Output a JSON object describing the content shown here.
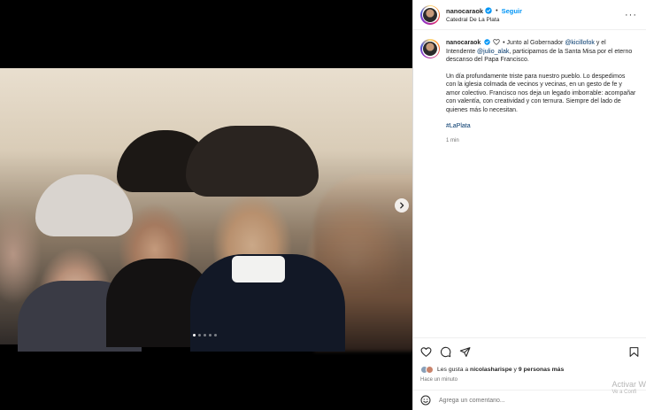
{
  "colors": {
    "accent": "#0095f6",
    "link": "#00376b",
    "muted": "#737373",
    "verified": "#0095f6"
  },
  "header": {
    "username": "nanocaraok",
    "separator": "•",
    "follow_label": "Seguir",
    "location": "Catedral De La Plata",
    "more_label": "···"
  },
  "media": {
    "slides_total": 5,
    "active_slide": 1
  },
  "caption": {
    "username": "nanocaraok",
    "pre_text": "• Junto al Gobernador",
    "mention1": "@kicillofok",
    "mid_text": "y el Intendente",
    "mention2": "@julio_alak",
    "post_text": ", participamos de la Santa Misa por el eterno descanso del Papa Francisco.",
    "paragraph": "Un día profundamente triste para nuestro pueblo. Lo despedimos con la iglesia colmada de vecinos y vecinas, en un gesto de fe y amor colectivo. Francisco nos deja un legado imborrable: acompañar con valentía, con creatividad y con ternura. Siempre del lado de quienes más lo necesitan.",
    "hashtag": "#LaPlata",
    "time": "1 min"
  },
  "likes": {
    "prefix": "Les gusta a",
    "user": "nicolasharispe",
    "middle": "y",
    "others": "9 personas más"
  },
  "posted_ago": "Hace un minuto",
  "comment": {
    "placeholder": "Agrega un comentario..."
  },
  "watermark": {
    "line1": "Activar W",
    "line2": "Ve a Confi"
  }
}
